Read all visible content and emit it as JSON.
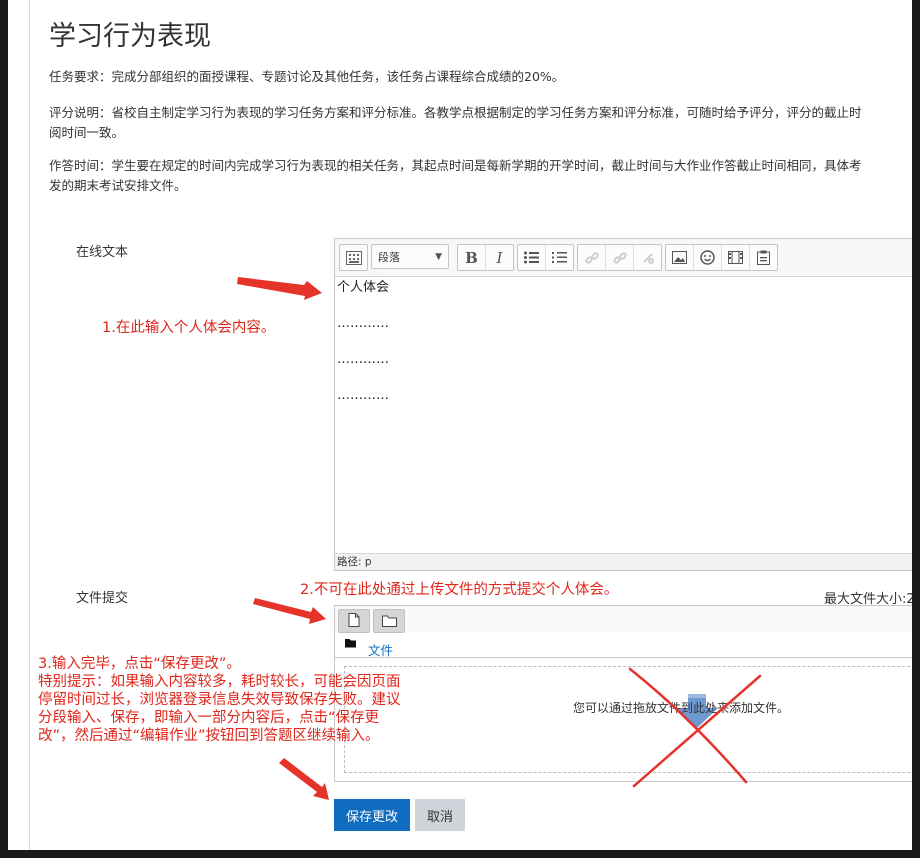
{
  "page": {
    "title": "学习行为表现",
    "task_requirement": "任务要求：完成分部组织的面授课程、专题讨论及其他任务，该任务占课程综合成绩的20%。",
    "grading_line1": "评分说明：省校自主制定学习行为表现的学习任务方案和评分标准。各教学点根据制定的学习任务方案和评分标准，可随时给予评分，评分的截止时",
    "grading_line2": "阅时间一致。",
    "answer_time_line1": "作答时间：学生要在规定的时间内完成学习行为表现的相关任务，其起点时间是每新学期的开学时间，截止时间与大作业作答截止时间相同，具体考",
    "answer_time_line2": "发的期末考试安排文件。"
  },
  "online_text": {
    "label": "在线文本",
    "paragraph_select": "段落",
    "content_lines": [
      "个人体会",
      "…………",
      "…………",
      "…………"
    ],
    "path_bar": "路径: p"
  },
  "file_submission": {
    "label": "文件提交",
    "max_size": "最大文件大小:2",
    "folder_label": "文件",
    "drop_hint": "您可以通过拖放文件到此处来添加文件。"
  },
  "buttons": {
    "save": "保存更改",
    "cancel": "取消"
  },
  "annotations": {
    "note1": "1.在此输入个人体会内容。",
    "note2": "2.不可在此处通过上传文件的方式提交个人体会。",
    "note3": "3.输入完毕，点击“保存更改”。\n特别提示：如果输入内容较多，耗时较长，可能会因页面\n停留时间过长，浏览器登录信息失效导致保存失败。建议\n分段输入、保存，即输入一部分内容后，点击“保存更\n改”，然后通过“编辑作业”按钮回到答题区继续输入。"
  },
  "colors": {
    "annotation_red": "#e0251a",
    "primary_button": "#0f6cbf",
    "link_blue": "#0f6cbf"
  },
  "icons": [
    "menu-toggle-icon",
    "bold-icon",
    "italic-icon",
    "unordered-list-icon",
    "ordered-list-icon",
    "link-icon",
    "unlink-icon",
    "anchor-icon",
    "image-icon",
    "emoji-icon",
    "media-icon",
    "paste-icon",
    "add-file-icon",
    "create-folder-icon",
    "folder-icon",
    "download-arrow-icon"
  ]
}
